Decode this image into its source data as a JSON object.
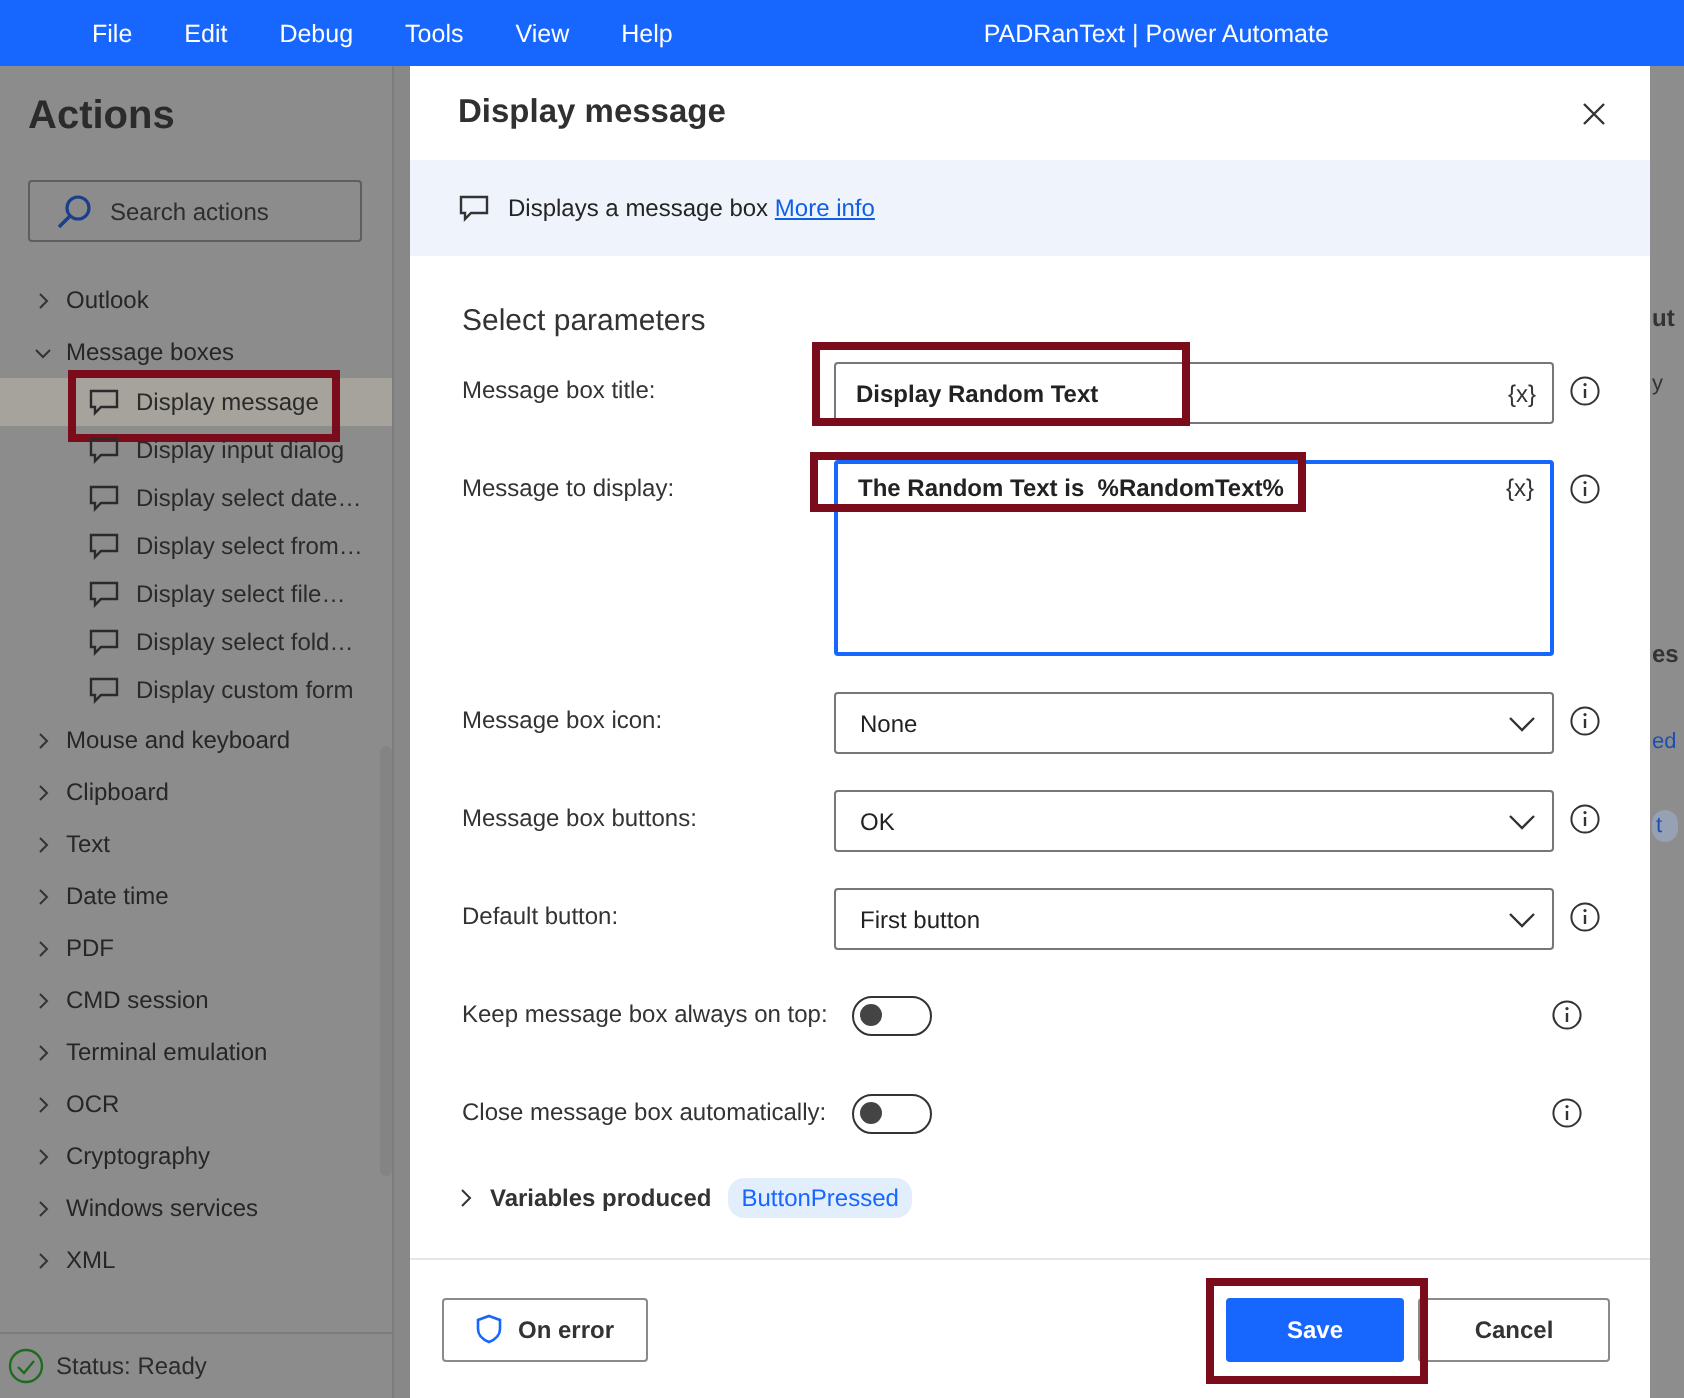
{
  "menu": {
    "items": [
      "File",
      "Edit",
      "Debug",
      "Tools",
      "View",
      "Help"
    ],
    "title": "PADRanText | Power Automate"
  },
  "sidebar": {
    "title": "Actions",
    "search": {
      "placeholder": "Search actions"
    },
    "groups": [
      {
        "label": "Outlook",
        "expanded": false
      },
      {
        "label": "Message boxes",
        "expanded": true,
        "children": [
          {
            "label": "Display message",
            "selected": true,
            "annotated": true
          },
          {
            "label": "Display input dialog",
            "selected": false,
            "annotated": false
          },
          {
            "label": "Display select date…",
            "selected": false,
            "annotated": false
          },
          {
            "label": "Display select from…",
            "selected": false,
            "annotated": false
          },
          {
            "label": "Display select file…",
            "selected": false,
            "annotated": false
          },
          {
            "label": "Display select fold…",
            "selected": false,
            "annotated": false
          },
          {
            "label": "Display custom form",
            "selected": false,
            "annotated": false
          }
        ]
      },
      {
        "label": "Mouse and keyboard",
        "expanded": false
      },
      {
        "label": "Clipboard",
        "expanded": false
      },
      {
        "label": "Text",
        "expanded": false
      },
      {
        "label": "Date time",
        "expanded": false
      },
      {
        "label": "PDF",
        "expanded": false
      },
      {
        "label": "CMD session",
        "expanded": false
      },
      {
        "label": "Terminal emulation",
        "expanded": false
      },
      {
        "label": "OCR",
        "expanded": false
      },
      {
        "label": "Cryptography",
        "expanded": false
      },
      {
        "label": "Windows services",
        "expanded": false
      },
      {
        "label": "XML",
        "expanded": false
      }
    ],
    "status": "Status: Ready"
  },
  "background_fragments": [
    {
      "text": "ut",
      "kind": "heading"
    },
    {
      "text": "y",
      "kind": "plain"
    },
    {
      "text": "es",
      "kind": "heading"
    },
    {
      "text": "ed",
      "kind": "link"
    },
    {
      "text": "t",
      "kind": "pill"
    }
  ],
  "dialog": {
    "title": "Display message",
    "description": "Displays a message box",
    "link": "More info",
    "section": "Select parameters",
    "params": [
      {
        "kind": "text",
        "label": "Message box title:",
        "value": "Display Random Text",
        "token": "{x}",
        "annotated": true
      },
      {
        "kind": "textarea",
        "label": "Message to display:",
        "value": "The Random Text is  %RandomText%",
        "token": "{x}",
        "annotated": true,
        "focused": true
      },
      {
        "kind": "dropdown",
        "label": "Message box icon:",
        "value": "None"
      },
      {
        "kind": "dropdown",
        "label": "Message box buttons:",
        "value": "OK"
      },
      {
        "kind": "dropdown",
        "label": "Default button:",
        "value": "First button"
      },
      {
        "kind": "toggle",
        "label": "Keep message box always on top:",
        "on": false
      },
      {
        "kind": "toggle",
        "label": "Close message box automatically:",
        "on": false
      }
    ],
    "variables": {
      "label": "Variables produced",
      "expanded": false,
      "tags": [
        "ButtonPressed"
      ]
    },
    "on_error": "On error",
    "save": {
      "label": "Save",
      "annotated": true
    },
    "cancel": "Cancel"
  }
}
